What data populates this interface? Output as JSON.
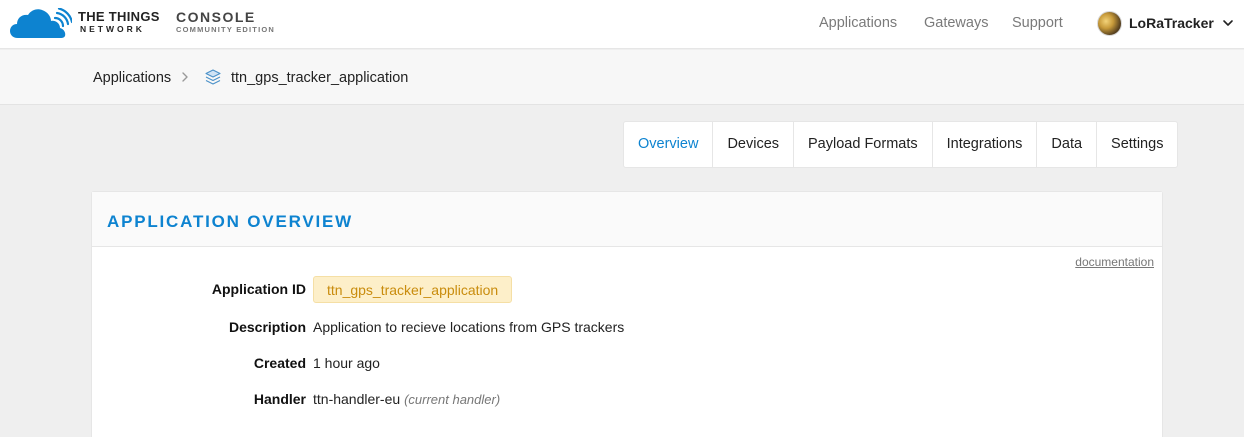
{
  "brand": {
    "ttn_line1": "THE THINGS",
    "ttn_line2": "NETWORK",
    "console_line1": "CONSOLE",
    "console_line2": "COMMUNITY EDITION"
  },
  "nav": {
    "applications": "Applications",
    "gateways": "Gateways",
    "support": "Support",
    "username": "LoRaTracker"
  },
  "breadcrumb": {
    "root": "Applications",
    "current": "ttn_gps_tracker_application"
  },
  "tabs": [
    "Overview",
    "Devices",
    "Payload Formats",
    "Integrations",
    "Data",
    "Settings"
  ],
  "active_tab": "Overview",
  "overview": {
    "title": "APPLICATION OVERVIEW",
    "documentation_link": "documentation",
    "fields": {
      "application_id_label": "Application ID",
      "application_id_value": "ttn_gps_tracker_application",
      "description_label": "Description",
      "description_value": "Application to recieve locations from GPS trackers",
      "created_label": "Created",
      "created_value": "1 hour ago",
      "handler_label": "Handler",
      "handler_value": "ttn-handler-eu",
      "handler_note": "(current handler)"
    }
  },
  "colors": {
    "accent": "#0d83d0",
    "chip_bg": "#fdefc9",
    "chip_text": "#c98c0d",
    "logo_blue": "#0d83d0"
  },
  "icons": {
    "logo": "ttn-cloud-icon",
    "breadcrumb_separator": "chevron-right-icon",
    "application": "stack-layers-icon",
    "user_menu": "chevron-down-icon"
  }
}
